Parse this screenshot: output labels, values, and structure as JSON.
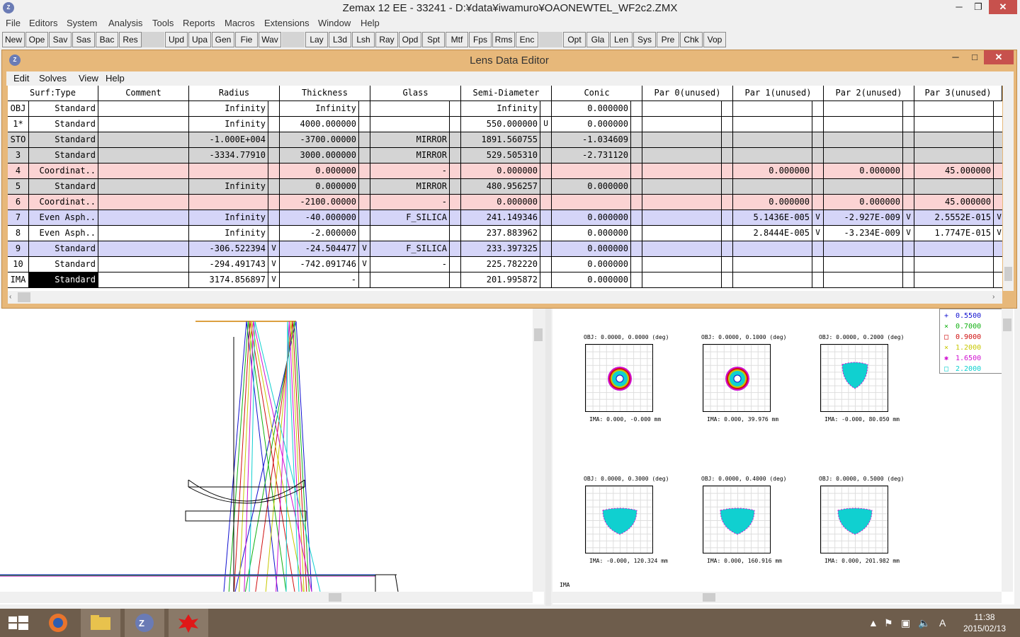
{
  "app": {
    "title": "Zemax 12 EE - 33241 - D:¥data¥iwamuro¥OAONEWTEL_WF2c2.ZMX",
    "icon_text": "Z",
    "min": "─",
    "max": "❐",
    "close": "✕"
  },
  "menu": [
    "File",
    "Editors",
    "System",
    "Analysis",
    "Tools",
    "Reports",
    "Macros",
    "Extensions",
    "Window",
    "Help"
  ],
  "toolbar": [
    "New",
    "Ope",
    "Sav",
    "Sas",
    "Bac",
    "Res",
    "Upd",
    "Upa",
    "Gen",
    "Fie",
    "Wav",
    "Lay",
    "L3d",
    "Lsh",
    "Ray",
    "Opd",
    "Spt",
    "Mtf",
    "Fps",
    "Rms",
    "Enc",
    "Opt",
    "Gla",
    "Len",
    "Sys",
    "Pre",
    "Chk",
    "Vop"
  ],
  "lde": {
    "title": "Lens Data Editor",
    "min": "─",
    "max": "□",
    "close": "✕",
    "menu": [
      "Edit",
      "Solves",
      "View",
      "Help"
    ],
    "headers": [
      "Surf:Type",
      "Comment",
      "Radius",
      "Thickness",
      "Glass",
      "Semi-Diameter",
      "Conic",
      "Par 0(unused)",
      "Par 1(unused)",
      "Par 2(unused)",
      "Par 3(unused)"
    ],
    "rows": [
      {
        "surf": "OBJ",
        "type": "Standard",
        "comment": "",
        "radius": "Infinity",
        "rf": "",
        "thick": "Infinity",
        "tf": "",
        "glass": "",
        "semi": "Infinity",
        "sf": "",
        "conic": "0.000000",
        "p1": "",
        "p1f": "",
        "p2": "",
        "p2f": "",
        "p3": "",
        "p3f": "",
        "color": "white"
      },
      {
        "surf": "1*",
        "type": "Standard",
        "comment": "",
        "radius": "Infinity",
        "rf": "",
        "thick": "4000.000000",
        "tf": "",
        "glass": "",
        "semi": "550.000000",
        "sf": "U",
        "conic": "0.000000",
        "p1": "",
        "p1f": "",
        "p2": "",
        "p2f": "",
        "p3": "",
        "p3f": "",
        "color": "white"
      },
      {
        "surf": "STO",
        "type": "Standard",
        "comment": "",
        "radius": "-1.000E+004",
        "rf": "",
        "thick": "-3700.00000",
        "tf": "",
        "glass": "MIRROR",
        "semi": "1891.560755",
        "sf": "",
        "conic": "-1.034609",
        "p1": "",
        "p1f": "",
        "p2": "",
        "p2f": "",
        "p3": "",
        "p3f": "",
        "color": "gray"
      },
      {
        "surf": "3",
        "type": "Standard",
        "comment": "",
        "radius": "-3334.77910",
        "rf": "",
        "thick": "3000.000000",
        "tf": "",
        "glass": "MIRROR",
        "semi": "529.505310",
        "sf": "",
        "conic": "-2.731120",
        "p1": "",
        "p1f": "",
        "p2": "",
        "p2f": "",
        "p3": "",
        "p3f": "",
        "color": "gray"
      },
      {
        "surf": "4",
        "type": "Coordinat..",
        "comment": "",
        "radius": "",
        "rf": "",
        "thick": "0.000000",
        "tf": "",
        "glass": "-",
        "semi": "0.000000",
        "sf": "",
        "conic": "",
        "p1": "0.000000",
        "p1f": "",
        "p2": "0.000000",
        "p2f": "",
        "p3": "45.000000",
        "p3f": "",
        "color": "pink"
      },
      {
        "surf": "5",
        "type": "Standard",
        "comment": "",
        "radius": "Infinity",
        "rf": "",
        "thick": "0.000000",
        "tf": "",
        "glass": "MIRROR",
        "semi": "480.956257",
        "sf": "",
        "conic": "0.000000",
        "p1": "",
        "p1f": "",
        "p2": "",
        "p2f": "",
        "p3": "",
        "p3f": "",
        "color": "gray"
      },
      {
        "surf": "6",
        "type": "Coordinat..",
        "comment": "",
        "radius": "",
        "rf": "",
        "thick": "-2100.00000",
        "tf": "",
        "glass": "-",
        "semi": "0.000000",
        "sf": "",
        "conic": "",
        "p1": "0.000000",
        "p1f": "",
        "p2": "0.000000",
        "p2f": "",
        "p3": "45.000000",
        "p3f": "",
        "color": "pink"
      },
      {
        "surf": "7",
        "type": "Even Asph..",
        "comment": "",
        "radius": "Infinity",
        "rf": "",
        "thick": "-40.000000",
        "tf": "",
        "glass": "F_SILICA",
        "semi": "241.149346",
        "sf": "",
        "conic": "0.000000",
        "p1": "5.1436E-005",
        "p1f": "V",
        "p2": "-2.927E-009",
        "p2f": "V",
        "p3": "2.5552E-015",
        "p3f": "V",
        "color": "blue"
      },
      {
        "surf": "8",
        "type": "Even Asph..",
        "comment": "",
        "radius": "Infinity",
        "rf": "",
        "thick": "-2.000000",
        "tf": "",
        "glass": "",
        "semi": "237.883962",
        "sf": "",
        "conic": "0.000000",
        "p1": "2.8444E-005",
        "p1f": "V",
        "p2": "-3.234E-009",
        "p2f": "V",
        "p3": "1.7747E-015",
        "p3f": "V",
        "color": "white"
      },
      {
        "surf": "9",
        "type": "Standard",
        "comment": "",
        "radius": "-306.522394",
        "rf": "V",
        "thick": "-24.504477",
        "tf": "V",
        "glass": "F_SILICA",
        "semi": "233.397325",
        "sf": "",
        "conic": "0.000000",
        "p1": "",
        "p1f": "",
        "p2": "",
        "p2f": "",
        "p3": "",
        "p3f": "",
        "color": "blue"
      },
      {
        "surf": "10",
        "type": "Standard",
        "comment": "",
        "radius": "-294.491743",
        "rf": "V",
        "thick": "-742.091746",
        "tf": "V",
        "glass": "-",
        "semi": "225.782220",
        "sf": "",
        "conic": "0.000000",
        "p1": "",
        "p1f": "",
        "p2": "",
        "p2f": "",
        "p3": "",
        "p3f": "",
        "color": "white"
      },
      {
        "surf": "IMA",
        "type": "Standard",
        "comment": "",
        "radius": "3174.856897",
        "rf": "V",
        "thick": "-",
        "tf": "",
        "glass": "",
        "semi": "201.995872",
        "sf": "",
        "conic": "0.000000",
        "p1": "",
        "p1f": "",
        "p2": "",
        "p2f": "",
        "p3": "",
        "p3f": "",
        "color": "white"
      }
    ]
  },
  "spot": {
    "legend": [
      {
        "label": "0.5500",
        "marker": "+",
        "color": "#1010d0"
      },
      {
        "label": "0.7000",
        "marker": "×",
        "color": "#10b010"
      },
      {
        "label": "0.9000",
        "marker": "□",
        "color": "#d01010"
      },
      {
        "label": "1.2000",
        "marker": "×",
        "color": "#c8c800"
      },
      {
        "label": "1.6500",
        "marker": "✱",
        "color": "#d010d0"
      },
      {
        "label": "2.2000",
        "marker": "□",
        "color": "#10d0d0"
      }
    ],
    "fields": [
      {
        "obj": "OBJ: 0.0000, 0.0000 (deg)",
        "ima": "IMA: 0.000, -0.000 mm"
      },
      {
        "obj": "OBJ: 0.0000, 0.1000 (deg)",
        "ima": "IMA: 0.000, 39.976 mm"
      },
      {
        "obj": "OBJ: 0.0000, 0.2000 (deg)",
        "ima": "IMA: -0.000, 80.050 mm"
      },
      {
        "obj": "OBJ: 0.0000, 0.3000 (deg)",
        "ima": "IMA: -0.000, 120.324 mm"
      },
      {
        "obj": "OBJ: 0.0000, 0.4000 (deg)",
        "ima": "IMA: 0.000, 160.916 mm"
      },
      {
        "obj": "OBJ: 0.0000, 0.5000 (deg)",
        "ima": "IMA: 0.000, 201.982 mm"
      }
    ],
    "footer": "IMA"
  },
  "taskbar": {
    "time": "11:38",
    "date": "2015/02/13",
    "ime": "A"
  },
  "colors": {
    "lde_frame": "#e7b87a",
    "row_gray": "#d4d4d4",
    "row_pink": "#fbd3d3",
    "row_blue": "#d5d5f8",
    "taskbar": "#6e5d4c"
  }
}
